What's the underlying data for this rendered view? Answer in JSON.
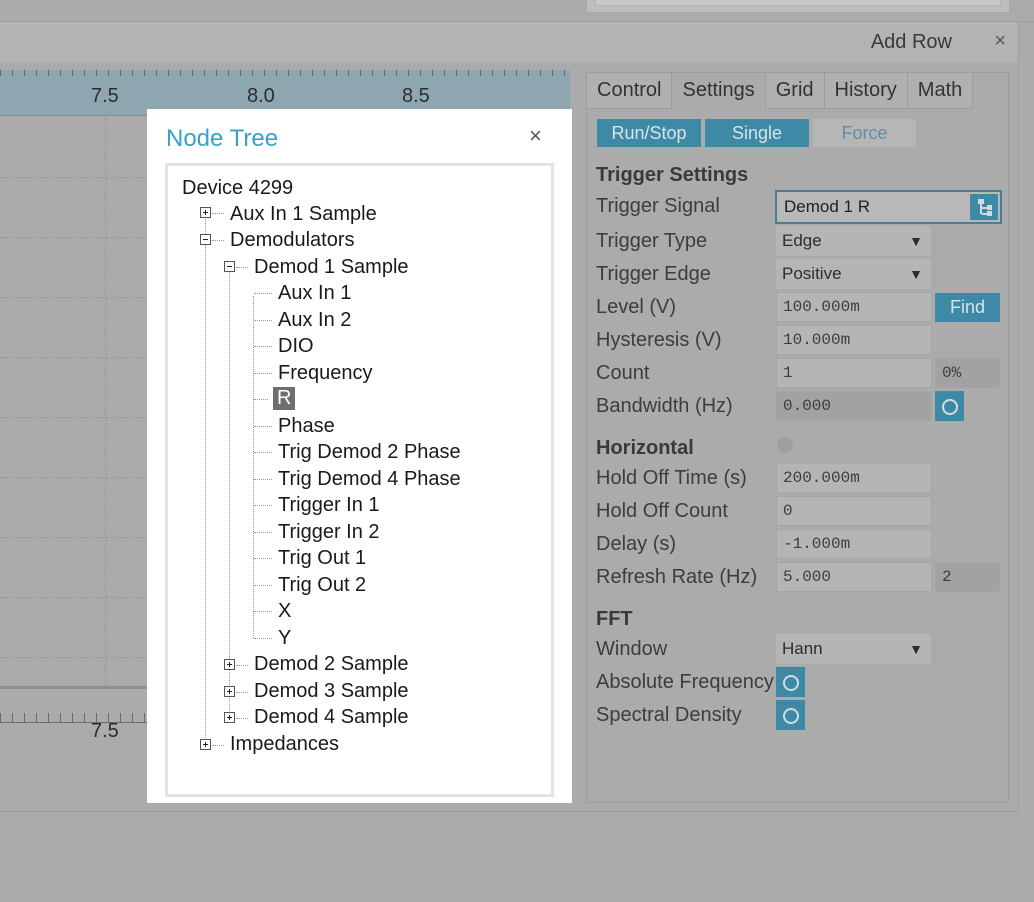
{
  "toolbar": {
    "add_row": "Add Row",
    "close": "×"
  },
  "plot": {
    "top_ticks": [
      "7.5",
      "8.0",
      "8.5"
    ],
    "bottom_tick": "7.5"
  },
  "settings": {
    "tabs": [
      "Control",
      "Settings",
      "Grid",
      "History",
      "Math"
    ],
    "active_tab": "Settings",
    "buttons": {
      "run_stop": "Run/Stop",
      "single": "Single",
      "force": "Force"
    },
    "trigger": {
      "section": "Trigger Settings",
      "signal_label": "Trigger Signal",
      "signal_value": "Demod 1 R",
      "type_label": "Trigger Type",
      "type_value": "Edge",
      "edge_label": "Trigger Edge",
      "edge_value": "Positive",
      "level_label": "Level (V)",
      "level_value": "100.000m",
      "find": "Find",
      "hysteresis_label": "Hysteresis (V)",
      "hysteresis_value": "10.000m",
      "count_label": "Count",
      "count_value": "1",
      "count_pct": "0%",
      "bandwidth_label": "Bandwidth (Hz)",
      "bandwidth_value": "0.000"
    },
    "horizontal": {
      "section": "Horizontal",
      "holdoff_time_label": "Hold Off Time (s)",
      "holdoff_time_value": "200.000m",
      "holdoff_count_label": "Hold Off Count",
      "holdoff_count_value": "0",
      "delay_label": "Delay (s)",
      "delay_value": "-1.000m",
      "refresh_label": "Refresh Rate (Hz)",
      "refresh_value": "5.000",
      "refresh_count": "2"
    },
    "fft": {
      "section": "FFT",
      "window_label": "Window",
      "window_value": "Hann",
      "abs_freq_label": "Absolute Frequency",
      "spectral_label": "Spectral Density"
    }
  },
  "dialog": {
    "title": "Node Tree",
    "close": "×",
    "tree": {
      "root": "Device 4299",
      "aux_in_1_sample": "Aux In 1 Sample",
      "demodulators": "Demodulators",
      "demod1": "Demod 1 Sample",
      "demod1_children": [
        "Aux In 1",
        "Aux In 2",
        "DIO",
        "Frequency",
        "R",
        "Phase",
        "Trig Demod 2 Phase",
        "Trig Demod 4 Phase",
        "Trigger In 1",
        "Trigger In 2",
        "Trig Out 1",
        "Trig Out 2",
        "X",
        "Y"
      ],
      "demod2": "Demod 2 Sample",
      "demod3": "Demod 3 Sample",
      "demod4": "Demod 4 Sample",
      "impedances": "Impedances",
      "selected": "R"
    }
  }
}
